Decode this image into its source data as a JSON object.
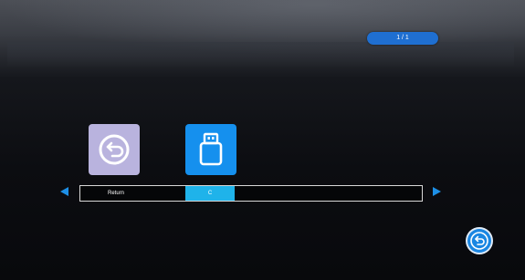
{
  "page_indicator": {
    "text": "1 / 1"
  },
  "sources": [
    {
      "label": "Return",
      "icon": "return-icon",
      "color": "#b9b3de",
      "selected": false
    },
    {
      "label": "C",
      "icon": "usb-drive-icon",
      "color": "#1590ee",
      "selected": true
    }
  ],
  "navigation": {
    "prev_icon": "left-arrow-icon",
    "next_icon": "right-arrow-icon",
    "back_icon": "back-return-icon"
  },
  "colors": {
    "accent": "#1590ee",
    "selected_label": "#1fb3ea",
    "return_tile": "#b9b3de"
  }
}
